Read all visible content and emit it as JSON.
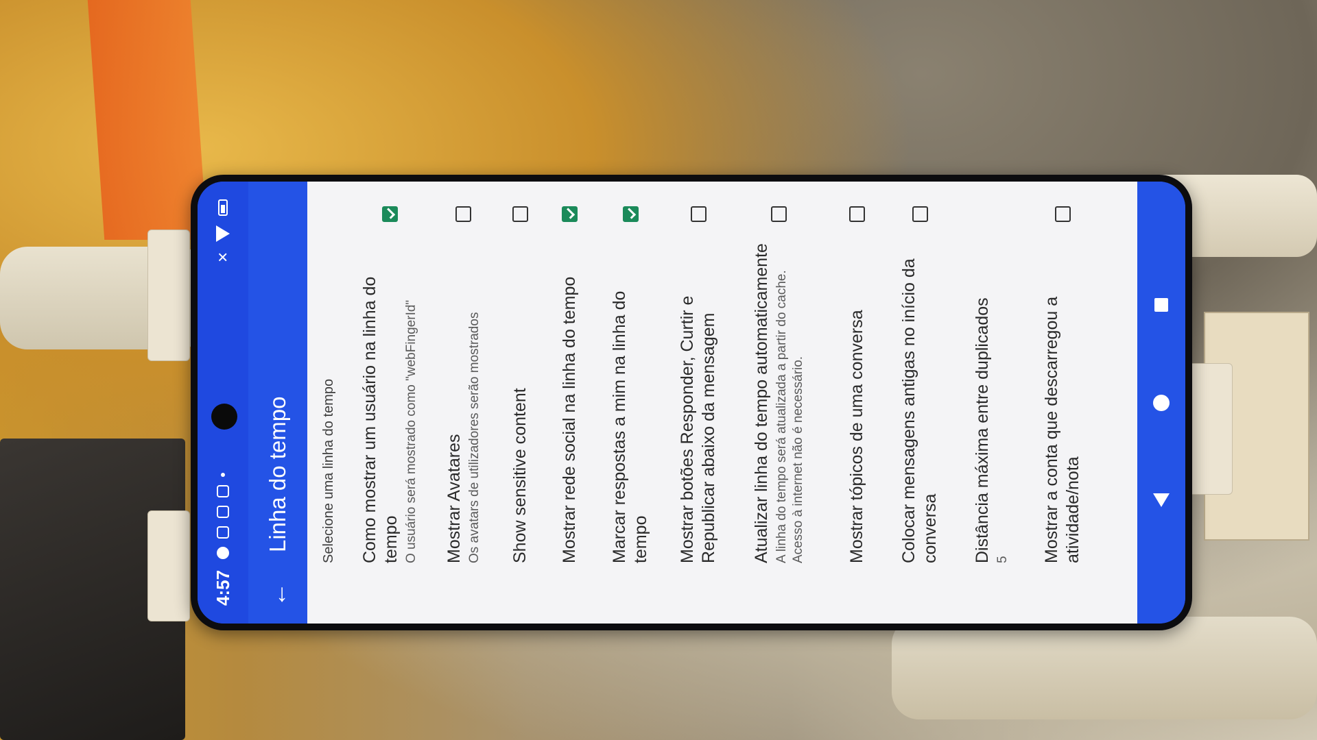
{
  "status_bar": {
    "time": "4:57"
  },
  "app_bar": {
    "title": "Linha do tempo"
  },
  "section": {
    "header": "Selecione uma linha do tempo"
  },
  "preferences": [
    {
      "title": "Como mostrar um usuário na linha do tempo",
      "summary": "O usuário será mostrado como \"webFingerId\"",
      "checked": true
    },
    {
      "title": "Mostrar Avatares",
      "summary": "Os avatars de utilizadores serão mostrados",
      "checked": false
    },
    {
      "title": "Show sensitive content",
      "summary": "",
      "checked": false
    },
    {
      "title": "Mostrar rede social na linha do tempo",
      "summary": "",
      "checked": true
    },
    {
      "title": "Marcar respostas a mim na linha do tempo",
      "summary": "",
      "checked": true
    },
    {
      "title": "Mostrar botões Responder, Curtir e Republicar abaixo da mensagem",
      "summary": "",
      "checked": false
    },
    {
      "title": "Atualizar linha do tempo automaticamente",
      "summary": "A linha do tempo será atualizada a partir do cache. Acesso à internet não é necessário.",
      "checked": false
    },
    {
      "title": "Mostrar tópicos de uma conversa",
      "summary": "",
      "checked": false
    },
    {
      "title": "Colocar mensagens antigas no início da conversa",
      "summary": "",
      "checked": false
    },
    {
      "title": "Distância máxima entre duplicados",
      "summary": "5",
      "checked": null
    },
    {
      "title": "Mostrar a conta que descarregou a atividade/nota",
      "summary": "",
      "checked": false
    }
  ],
  "colors": {
    "primary": "#2453e6",
    "checkbox_checked": "#1b8a5a",
    "background": "#f4f4f6"
  },
  "icons": {
    "back": "arrow-left-icon",
    "nav_back": "triangle-back-icon",
    "nav_home": "circle-home-icon",
    "nav_recents": "square-recents-icon"
  }
}
